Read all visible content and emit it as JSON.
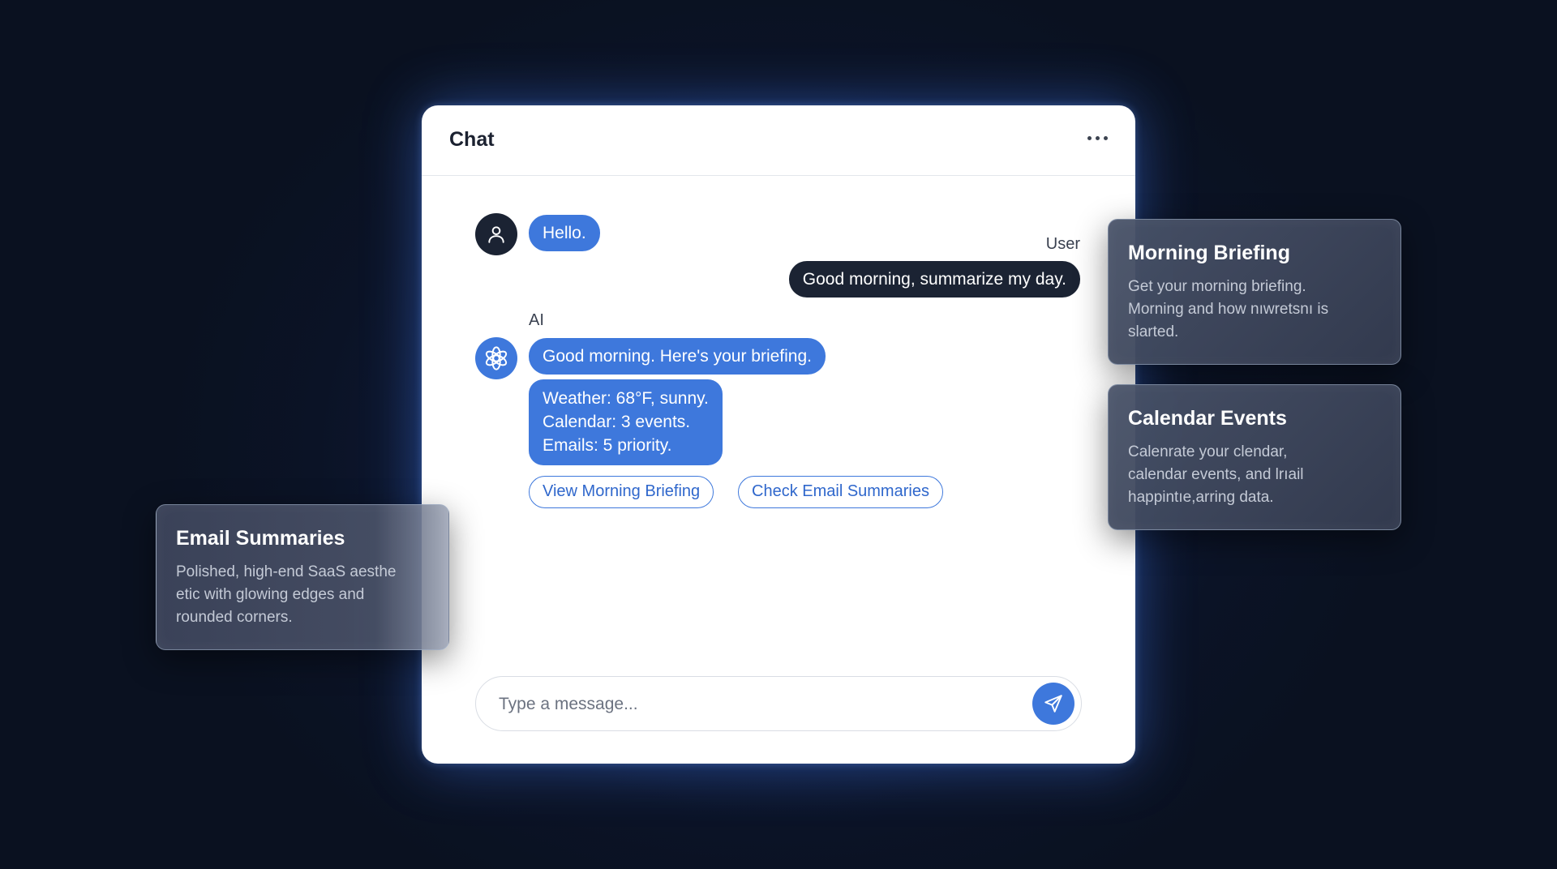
{
  "chat": {
    "title": "Chat",
    "more_icon": "more-horizontal-icon",
    "messages": {
      "user_hello": "Hello.",
      "user_label": "User",
      "user_request": "Good morning, summarize my day.",
      "ai_label": "AI",
      "ai_greeting": "Good morning. Here's your briefing.",
      "ai_details": [
        "Weather: 68°F, sunny.",
        "Calendar: 3 events.",
        "Emails: 5 priority."
      ]
    },
    "actions": {
      "view_morning_briefing": "View Morning Briefing",
      "check_email_summaries": "Check Email Summaries"
    },
    "composer": {
      "placeholder": "Type a message...",
      "value": "",
      "send_icon": "send-icon"
    },
    "icons": {
      "user_avatar": "user-icon",
      "ai_avatar": "ai-logo-icon"
    }
  },
  "cards": {
    "morning_briefing": {
      "title": "Morning Briefing",
      "lines": [
        "Get your morning briefing.",
        "Morning and how nıwretsnı is",
        "slarted."
      ]
    },
    "calendar_events": {
      "title": "Calendar Events",
      "lines": [
        "Calenrate your clendar,",
        "calendar events, and lrıail",
        "happintıe,arring data."
      ]
    },
    "email_summaries": {
      "title": "Email Summaries",
      "lines": [
        "Polished, high-end SaaS aesthe",
        "etic with glowing edges and",
        "rounded corners."
      ]
    }
  },
  "colors": {
    "background": "#0b1224",
    "accent_blue": "#3e78dc",
    "dark_bubble": "#1b2333",
    "card_bg": "#485268",
    "window_bg": "#ffffff"
  }
}
